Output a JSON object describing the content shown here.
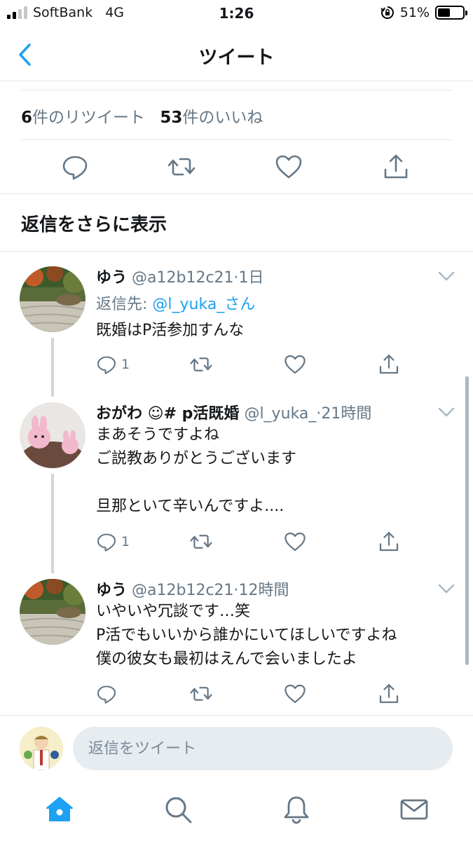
{
  "status_bar": {
    "carrier": "SoftBank",
    "network": "4G",
    "time": "1:26",
    "battery_percent": "51%",
    "battery_level": 0.51
  },
  "nav": {
    "title": "ツイート",
    "back_icon": "chevron-left-icon"
  },
  "stats": {
    "retweets_count": "6",
    "retweets_label": "件のリツイート",
    "likes_count": "53",
    "likes_label": "件のいいね"
  },
  "main_actions": [
    "reply-icon",
    "retweet-icon",
    "like-icon",
    "share-icon"
  ],
  "show_more_replies": "返信をさらに表示",
  "tweets": [
    {
      "name": "ゆう",
      "handle": "@a12b12c21",
      "time": "1日",
      "reply_to_label": "返信先: ",
      "reply_to_user": "@l_yuka_さん",
      "text": "既婚はP活参加すんな",
      "reply_count": "1"
    },
    {
      "name": "おがわ ☺︎# p活既婚",
      "handle": "@l_yuka_",
      "time": "21時間",
      "text": "まあそうですよね\nご説教ありがとうございます\n\n旦那といて辛いんですよ....",
      "reply_count": "1"
    },
    {
      "name": "ゆう",
      "handle": "@a12b12c21",
      "time": "12時間",
      "text": "いやいや冗談です…笑\nP活でもいいから誰かにいてほしいですよね\n僕の彼女も最初はえんで会いましたよ",
      "reply_count": ""
    }
  ],
  "compose": {
    "placeholder": "返信をツイート"
  },
  "tabbar": [
    "home-icon",
    "search-icon",
    "notifications-icon",
    "messages-icon"
  ],
  "colors": {
    "accent": "#1da1f2",
    "muted": "#657786",
    "divider": "#e1e8ed"
  }
}
